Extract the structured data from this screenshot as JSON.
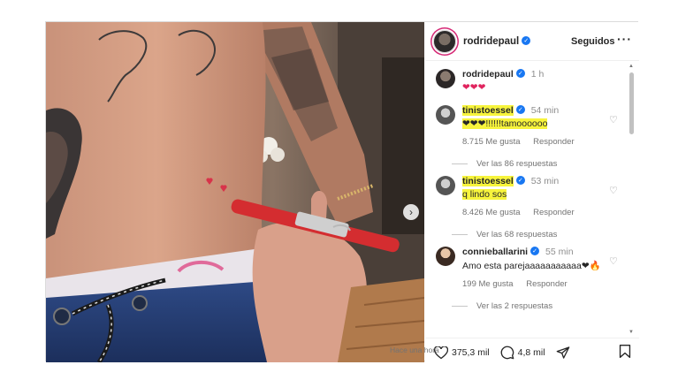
{
  "header": {
    "username": "rodridepaul",
    "follow_label": "Seguidos",
    "more_label": "···"
  },
  "caption": {
    "username": "rodridepaul",
    "time": "1 h",
    "text": "❤❤❤"
  },
  "comments": [
    {
      "username": "tinistoessel",
      "time": "54 min",
      "text": "❤❤❤!!!!!!tamoooooo",
      "likes": "8.715 Me gusta",
      "reply_label": "Responder",
      "replies": "Ver las 86 respuestas",
      "highlighted": true
    },
    {
      "username": "tinistoessel",
      "time": "53 min",
      "text": "q lindo sos",
      "likes": "8.426 Me gusta",
      "reply_label": "Responder",
      "replies": "Ver las 68 respuestas",
      "highlighted": true
    },
    {
      "username": "connieballarini",
      "time": "55 min",
      "text": "Amo esta parejaaaaaaaaaaa❤🔥",
      "likes": "199 Me gusta",
      "reply_label": "Responder",
      "replies": "Ver las 2 respuestas",
      "highlighted": false
    }
  ],
  "actions": {
    "likes_count": "375,3 mil",
    "comments_count": "4,8 mil"
  },
  "time_ago": "Hace una hora",
  "icons": {
    "verified": "verified-badge-icon",
    "next": "chevron-right-icon",
    "like": "heart-outline-icon",
    "comment": "comment-bubble-icon",
    "share": "paper-plane-icon",
    "save": "bookmark-icon"
  },
  "colors": {
    "accent_blue": "#1877f2",
    "highlight": "#f7f43c",
    "heart_red": "#e0245e"
  }
}
